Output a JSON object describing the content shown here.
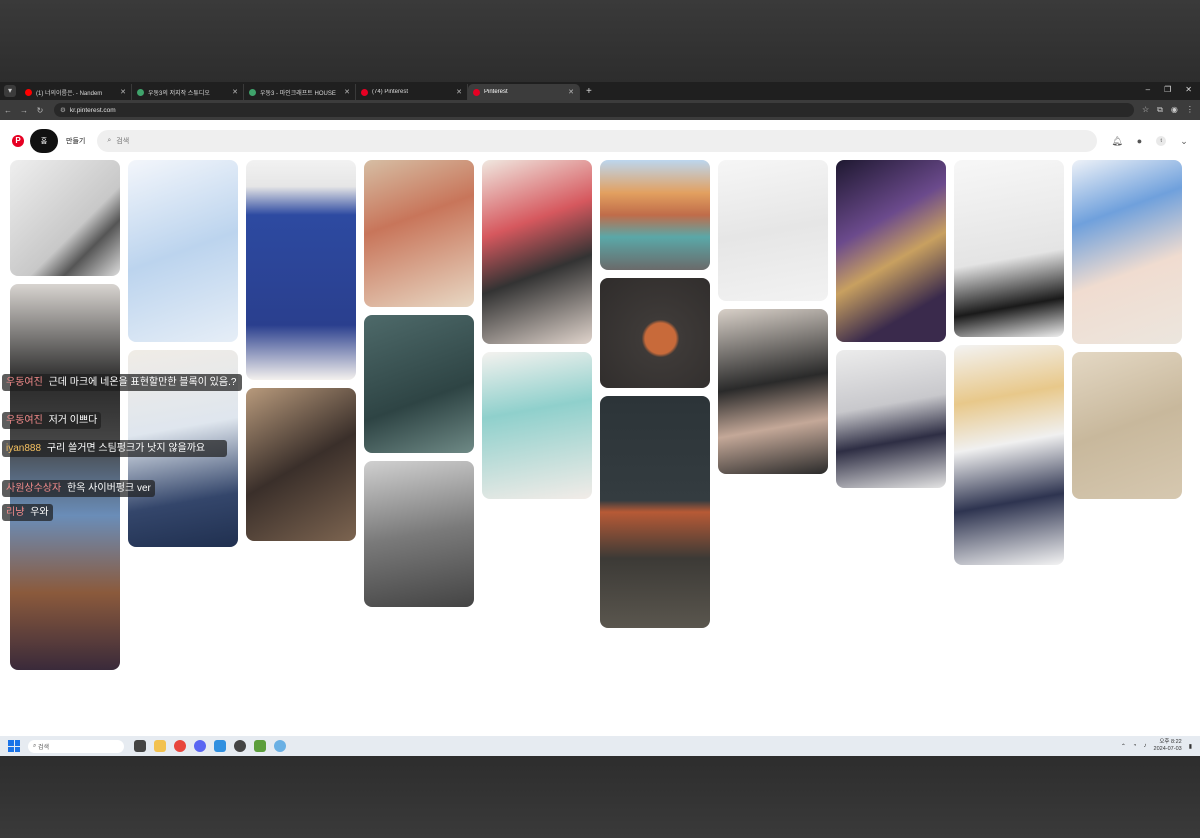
{
  "browser": {
    "tabs": [
      {
        "label": "(1) 너의이름은. - Nandem",
        "favicon_color": "#ff0000",
        "active": false
      },
      {
        "label": "우동3의 저지작 스튜디오",
        "favicon_color": "#3fa36b",
        "active": false
      },
      {
        "label": "우동3 - 마인크래프트 HOUSE",
        "favicon_color": "#3fa36b",
        "active": false
      },
      {
        "label": "(74) Pinterest",
        "favicon_color": "#e60023",
        "active": false
      },
      {
        "label": "Pinterest",
        "favicon_color": "#e60023",
        "active": true
      }
    ],
    "address": "kr.pinterest.com",
    "new_tab": "+",
    "window_controls": [
      "–",
      "❐",
      "✕"
    ]
  },
  "pinterest": {
    "logo": "P",
    "home_label": "홈",
    "create_label": "만들기",
    "search_placeholder": "검색",
    "avatar_initial": "t"
  },
  "chat": [
    {
      "user": "우동여진",
      "text": "근데 마크에 네온을 표현할만한 블록이 있음.?",
      "user_style": "pink"
    },
    {
      "user": "우동여진",
      "text": "저거 이쁘다",
      "user_style": "pink"
    },
    {
      "user": "iyan888",
      "text": "구리 쓸거면 스팀펑크가 낫지 않을까요",
      "user_style": "gold"
    },
    {
      "user": "사원상수상자",
      "text": "한옥 사이버펑크 ver",
      "user_style": "pink"
    },
    {
      "user": "리냥",
      "text": "우와",
      "user_style": "pink"
    }
  ],
  "taskbar": {
    "search_placeholder": "검색",
    "time": "오후 8:22",
    "date": "2024-07-03"
  },
  "colors": {
    "pinterest_red": "#e60023",
    "chrome_dark": "#1f1f1f",
    "toolbar": "#3c3c3c"
  }
}
